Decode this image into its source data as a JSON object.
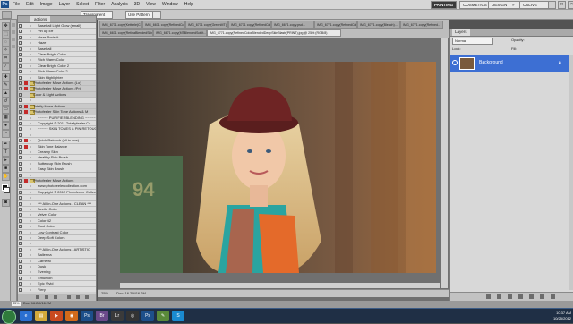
{
  "app": {
    "logo": "Ps"
  },
  "menu": [
    "File",
    "Edit",
    "Image",
    "Layer",
    "Select",
    "Filter",
    "Analysis",
    "3D",
    "View",
    "Window",
    "Help"
  ],
  "workspace": {
    "painting": "PAINTING",
    "cs_live": "CSLIVE",
    "cosmetics": "COSMETICS",
    "design": "DESIGN",
    "more": "»"
  },
  "options_bar": {
    "mode_value": "Transparent",
    "tolerance_value": "Use Pattern"
  },
  "actions_panel": {
    "tab_label": "actions",
    "rows": [
      {
        "label": "Baseball Light Glow (small)",
        "set": false,
        "red": false
      },
      {
        "label": "Pin up Eff",
        "set": false,
        "red": false
      },
      {
        "label": "Haze Portrait",
        "set": false,
        "red": false
      },
      {
        "label": "Haze",
        "set": false,
        "red": false
      },
      {
        "label": "Baseball",
        "set": false,
        "red": false
      },
      {
        "label": "Clear Bright Color",
        "set": false,
        "red": false
      },
      {
        "label": "Rich Warm Color",
        "set": false,
        "red": false
      },
      {
        "label": "Clear Bright Color 2",
        "set": false,
        "red": false
      },
      {
        "label": "Rich Warm Color 2",
        "set": false,
        "red": false
      },
      {
        "label": "Skin Highlighter",
        "set": false,
        "red": false
      },
      {
        "label": "Photofeeler Muse Actions (Lo)",
        "set": true,
        "red": true
      },
      {
        "label": "Photofeeler Muse Actions (Pr)",
        "set": true,
        "red": true
      },
      {
        "label": "Color & Light Actions",
        "set": true,
        "red": false
      },
      {
        "label": "",
        "set": false,
        "red": false
      },
      {
        "label": "Totally Muse Actions",
        "set": true,
        "red": true
      },
      {
        "label": "Photofeeler Skin Tone Actions & M",
        "set": true,
        "red": true
      },
      {
        "label": "~~~~~ PURIFIERBLENDING ~~~~~",
        "set": false,
        "red": false
      },
      {
        "label": "Copyright © 2011 Totallyfeeler.Co",
        "set": false,
        "red": false
      },
      {
        "label": "~~~~~ SKIN TONES & PIN RETOUCH",
        "set": false,
        "red": false
      },
      {
        "label": "",
        "set": false,
        "red": false
      },
      {
        "label": "Quick Retouch (all in one)",
        "set": false,
        "red": true
      },
      {
        "label": "Skin Tone Balance",
        "set": false,
        "red": true
      },
      {
        "label": "Creamy Skin",
        "set": false,
        "red": false
      },
      {
        "label": "Healthy Skin Brush",
        "set": false,
        "red": false
      },
      {
        "label": "Buttercup Skin Brush",
        "set": false,
        "red": false
      },
      {
        "label": "Easy Skin Brush",
        "set": false,
        "red": false
      },
      {
        "label": "",
        "set": false,
        "red": false
      },
      {
        "label": "Photofeeler Muse Actions",
        "set": true,
        "red": true
      },
      {
        "label": "www.photofeelercollection.com",
        "set": false,
        "red": false
      },
      {
        "label": "Copyright © 2012 Photofeeler Collecti",
        "set": false,
        "red": false
      },
      {
        "label": "",
        "set": false,
        "red": false
      },
      {
        "label": "*** All-in-One Actions - CLEAN ***",
        "set": false,
        "red": false
      },
      {
        "label": "Beetle Color",
        "set": false,
        "red": false
      },
      {
        "label": "Velvet Color",
        "set": false,
        "red": false
      },
      {
        "label": "Color 42",
        "set": false,
        "red": false
      },
      {
        "label": "Cool Color",
        "set": false,
        "red": false
      },
      {
        "label": "Low Contrast Color",
        "set": false,
        "red": false
      },
      {
        "label": "Deep Soft Colors",
        "set": false,
        "red": false
      },
      {
        "label": "",
        "set": false,
        "red": false
      },
      {
        "label": "*** All-in-One Actions - ARTISTIC",
        "set": false,
        "red": false
      },
      {
        "label": "Ballerina",
        "set": false,
        "red": false
      },
      {
        "label": "Carnival",
        "set": false,
        "red": false
      },
      {
        "label": "Dusk",
        "set": false,
        "red": false
      },
      {
        "label": "Evening",
        "set": false,
        "red": false
      },
      {
        "label": "Emulsion",
        "set": false,
        "red": false
      },
      {
        "label": "Epic Vivid",
        "set": false,
        "red": false
      },
      {
        "label": "Fiery",
        "set": false,
        "red": false
      }
    ]
  },
  "document_tabs": [
    {
      "label": "IMG_6771.copy(Ketterle)ColorBlaz(edited copy 3 @ 33.3% (RGB/8)",
      "active": false
    },
    {
      "label": "IMG_6671 copy(RefinedColorBlendedDeepSkinBlastr(RGB)...",
      "active": false
    },
    {
      "label": "IMG_6771 copy(GreenMT(BlendedPortraitBleach...",
      "active": false
    },
    {
      "label": "IMG_6771 copy(RefinedColorBleach...",
      "active": false
    },
    {
      "label": "IMG_6671.copy.psd...",
      "active": false
    },
    {
      "label": "IMG_6771.copy(RefinedColorBlend...",
      "active": false
    },
    {
      "label": "IMG_6771.copy(Bleach)...",
      "active": false
    },
    {
      "label": "IMG_6771.copy(Refined...",
      "active": false
    },
    {
      "label": "IMG_6671 copy(RetinaBlendedSkin...",
      "active": false
    },
    {
      "label": "IMG_6671.copy(MTBlendedSoftIt...",
      "active": false
    },
    {
      "label": "IMG_6771.copy(RefinedColorBlendedDeepSkinBlastr(PRINT).jpg @ 25% (RGB/8)",
      "active": true
    }
  ],
  "status": {
    "zoom": "25%",
    "doc_size": "Doc: 16.2M/16.2M"
  },
  "layers_panel": {
    "tab_label": "Layers",
    "blend_mode": "Normal",
    "opacity_label": "Opacity:",
    "lock_label": "Lock:",
    "fill_label": "Fill:",
    "layer_name": "Background"
  },
  "taskbar": {
    "apps": [
      {
        "name": "ie",
        "color": "#2a6fd0",
        "glyph": "e"
      },
      {
        "name": "folder",
        "color": "#d3a93a",
        "glyph": "▤"
      },
      {
        "name": "media",
        "color": "#c94a1f",
        "glyph": "▶"
      },
      {
        "name": "firefox",
        "color": "#d26a1a",
        "glyph": "◉"
      },
      {
        "name": "photoshop",
        "color": "#1d4f8a",
        "glyph": "Ps"
      },
      {
        "name": "bridge",
        "color": "#6b4a8a",
        "glyph": "Br"
      },
      {
        "name": "lightroom",
        "color": "#3a3a3a",
        "glyph": "Lr"
      },
      {
        "name": "camera",
        "color": "#333333",
        "glyph": "◎"
      },
      {
        "name": "photoshop2",
        "color": "#1d4f8a",
        "glyph": "Ps"
      },
      {
        "name": "paint",
        "color": "#5a8a3a",
        "glyph": "✎"
      },
      {
        "name": "skype",
        "color": "#1a8ad0",
        "glyph": "S"
      }
    ],
    "time": "10:37 AM",
    "date": "10/25/2012"
  },
  "colors": {
    "accent": "#3d6fd3",
    "workspace_active": "#3a3a3a"
  }
}
